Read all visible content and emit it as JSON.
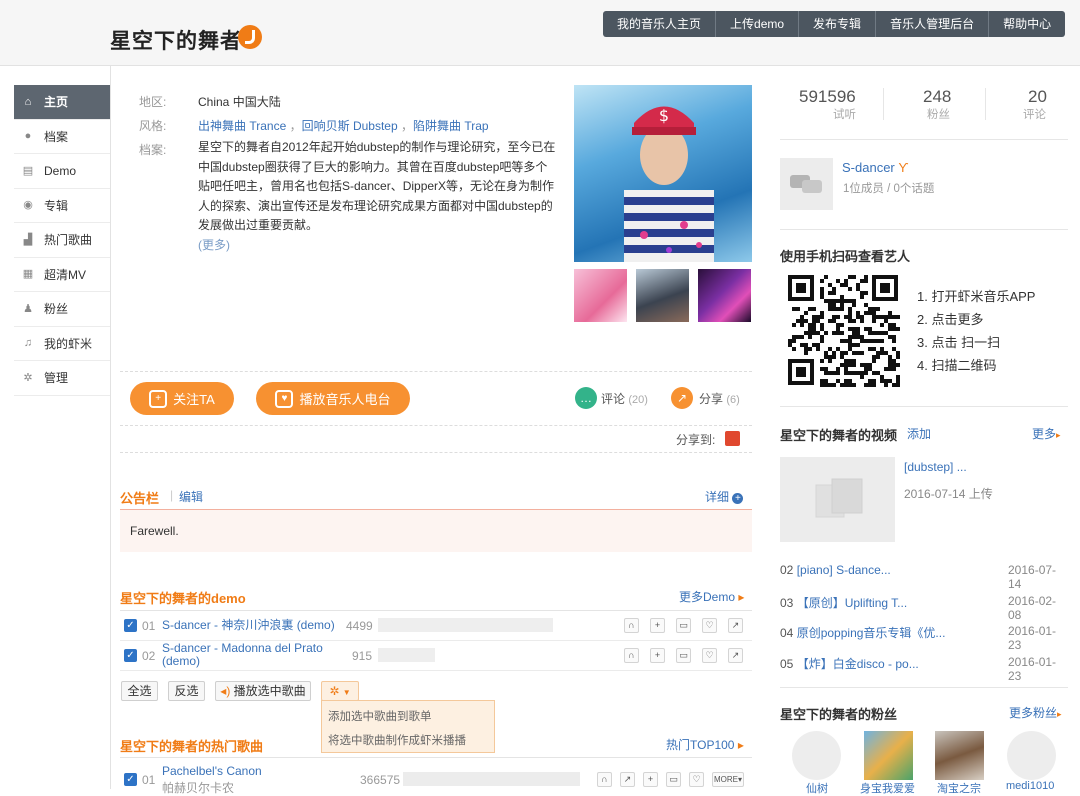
{
  "header": {
    "artist_title": "星空下的舞者",
    "nav": [
      "我的音乐人主页",
      "上传demo",
      "发布专辑",
      "音乐人管理后台",
      "帮助中心"
    ]
  },
  "sidebar": {
    "items": [
      {
        "label": "主页",
        "icon": "home-icon",
        "active": true
      },
      {
        "label": "档案",
        "icon": "person-icon"
      },
      {
        "label": "Demo",
        "icon": "document-icon"
      },
      {
        "label": "专辑",
        "icon": "disc-icon"
      },
      {
        "label": "热门歌曲",
        "icon": "chart-icon"
      },
      {
        "label": "超清MV",
        "icon": "video-icon"
      },
      {
        "label": "粉丝",
        "icon": "fans-icon"
      },
      {
        "label": "我的虾米",
        "icon": "music-note-icon"
      },
      {
        "label": "管理",
        "icon": "gear-icon"
      }
    ]
  },
  "profile": {
    "region_label": "地区:",
    "region_value": "China 中国大陆",
    "style_label": "风格:",
    "styles": [
      "出神舞曲 Trance",
      "回响贝斯 Dubstep",
      "陷阱舞曲 Trap"
    ],
    "styles_sep": "，",
    "bio_label": "档案:",
    "bio": "星空下的舞者自2012年起开始dubstep的制作与理论研究，至今已在中国dubstep圈获得了巨大的影响力。其曾在百度dubstep吧等多个贴吧任吧主，曾用名也包括S-dancer、DipperX等，无论在身为制作人的探索、演出宣传还是发布理论研究成果方面都对中国dubstep的发展做出过重要贡献。",
    "more": "(更多)"
  },
  "actions": {
    "follow": "关注TA",
    "radio": "播放音乐人电台",
    "comment": "评论",
    "comment_count": "(20)",
    "share": "分享",
    "share_count": "(6)",
    "share_to": "分享到:"
  },
  "notice": {
    "title": "公告栏",
    "edit": "编辑",
    "detail": "详细",
    "content": "Farewell."
  },
  "demo": {
    "title": "星空下的舞者的demo",
    "more": "更多Demo",
    "songs": [
      {
        "num": "01",
        "title": "S-dancer - 神奈川沖浪裏 (demo)",
        "count": "4499",
        "fill": 0.92
      },
      {
        "num": "02",
        "title": "S-dancer - Madonna del Prato (demo)",
        "count": "915",
        "fill": 0.3
      }
    ],
    "select_all": "全选",
    "invert": "反选",
    "play_selected": "播放选中歌曲",
    "menu": [
      "添加选中歌曲到歌单",
      "将选中歌曲制作成虾米播播"
    ]
  },
  "hot": {
    "title": "星空下的舞者的热门歌曲",
    "more": "热门TOP100",
    "songs": [
      {
        "num": "01",
        "title": "Pachelbel's Canon",
        "subtitle": "帕赫贝尔卡农",
        "count": "366575",
        "more_label": "MORE"
      }
    ]
  },
  "stats": [
    {
      "num": "591596",
      "label": "试听"
    },
    {
      "num": "248",
      "label": "粉丝"
    },
    {
      "num": "20",
      "label": "评论"
    }
  ],
  "group": {
    "name": "S-dancer",
    "sub": "1位成员 / 0个话题"
  },
  "qr": {
    "title": "使用手机扫码查看艺人",
    "steps": [
      "1. 打开虾米音乐APP",
      "2. 点击更多",
      "3. 点击 扫一扫",
      "4. 扫描二维码"
    ]
  },
  "videos": {
    "title": "星空下的舞者的视频",
    "add": "添加",
    "more": "更多",
    "feature_title": "[dubstep] ...",
    "feature_date": "2016-07-14 上传",
    "list": [
      {
        "num": "02",
        "title": "[piano] S-dance...",
        "date": "2016-07-14"
      },
      {
        "num": "03",
        "title": "【原创】Uplifting T...",
        "date": "2016-02-08"
      },
      {
        "num": "04",
        "title": "原创popping音乐专辑《优...",
        "date": "2016-01-23"
      },
      {
        "num": "05",
        "title": "【炸】白金disco - po...",
        "date": "2016-01-23"
      }
    ]
  },
  "fans": {
    "title": "星空下的舞者的粉丝",
    "more": "更多粉丝",
    "names": [
      "仙树",
      "身宝我爱爱",
      "淘宝之宗",
      "medi1010"
    ]
  },
  "colors": {
    "accent": "#f79131",
    "link": "#3a72b8",
    "nav_bg": "#4c5660",
    "checkbox": "#2d73c6"
  }
}
